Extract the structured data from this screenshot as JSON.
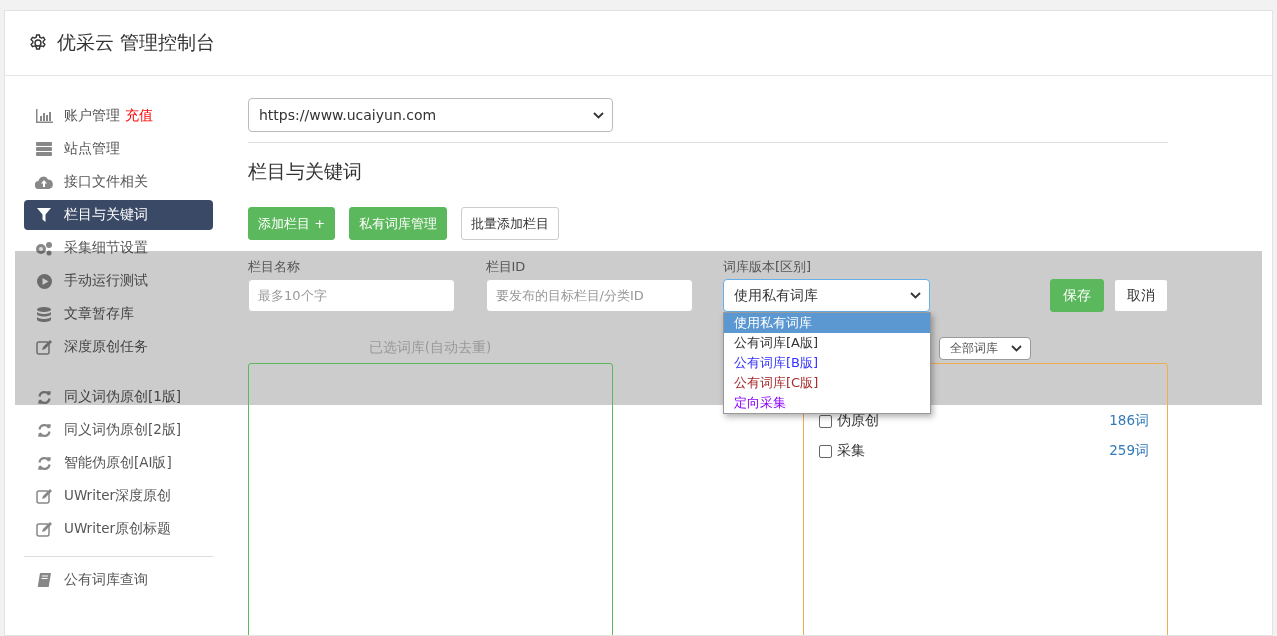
{
  "header": {
    "title": "优采云 管理控制台"
  },
  "sidebar": {
    "items": [
      {
        "label": "账户管理",
        "badge": "充值",
        "selected": false
      },
      {
        "label": "站点管理",
        "selected": false
      },
      {
        "label": "接口文件相关",
        "selected": false
      },
      {
        "label": "栏目与关键词",
        "selected": true
      },
      {
        "label": "采集细节设置",
        "selected": false
      },
      {
        "label": "手动运行测试",
        "selected": false
      },
      {
        "label": "文章暂存库",
        "selected": false
      },
      {
        "label": "深度原创任务",
        "selected": false
      },
      {
        "label": "同义词伪原创[1版]",
        "selected": false
      },
      {
        "label": "同义词伪原创[2版]",
        "selected": false
      },
      {
        "label": "智能伪原创[AI版]",
        "selected": false
      },
      {
        "label": "UWriter深度原创",
        "selected": false
      },
      {
        "label": "UWriter原创标题",
        "selected": false
      },
      {
        "label": "公有词库查询",
        "selected": false
      }
    ]
  },
  "site_select": {
    "value": "https://www.ucaiyun.com"
  },
  "section_title": "栏目与关键词",
  "buttons": [
    {
      "label": "添加栏目 +",
      "kind": "primary"
    },
    {
      "label": "私有词库管理",
      "kind": "primary"
    },
    {
      "label": "批量添加栏目",
      "kind": "default"
    }
  ],
  "form": {
    "fields": [
      {
        "label": "栏目名称",
        "placeholder": "最多10个字"
      },
      {
        "label": "栏目ID",
        "placeholder": "要发布的目标栏目/分类ID"
      }
    ],
    "version": {
      "label": "词库版本[区别]",
      "value": "使用私有词库",
      "options": [
        {
          "label": "使用私有词库",
          "selected": true
        },
        {
          "label": "公有词库[A版]",
          "selected": false,
          "color": "#333333"
        },
        {
          "label": "公有词库[B版]",
          "selected": false,
          "color": "#3333ff"
        },
        {
          "label": "公有词库[C版]",
          "selected": false,
          "color": "#a52a2a"
        },
        {
          "label": "定向采集",
          "selected": false,
          "color": "#8800ff"
        }
      ]
    },
    "save": "保存",
    "cancel": "取消"
  },
  "selected_box": {
    "label": "已选词库(自动去重)"
  },
  "library": {
    "filter": "全部词库",
    "items": [
      {
        "label": "伪原创",
        "count": "186词",
        "checked": false
      },
      {
        "label": "采集",
        "count": "259词",
        "checked": false
      }
    ]
  }
}
